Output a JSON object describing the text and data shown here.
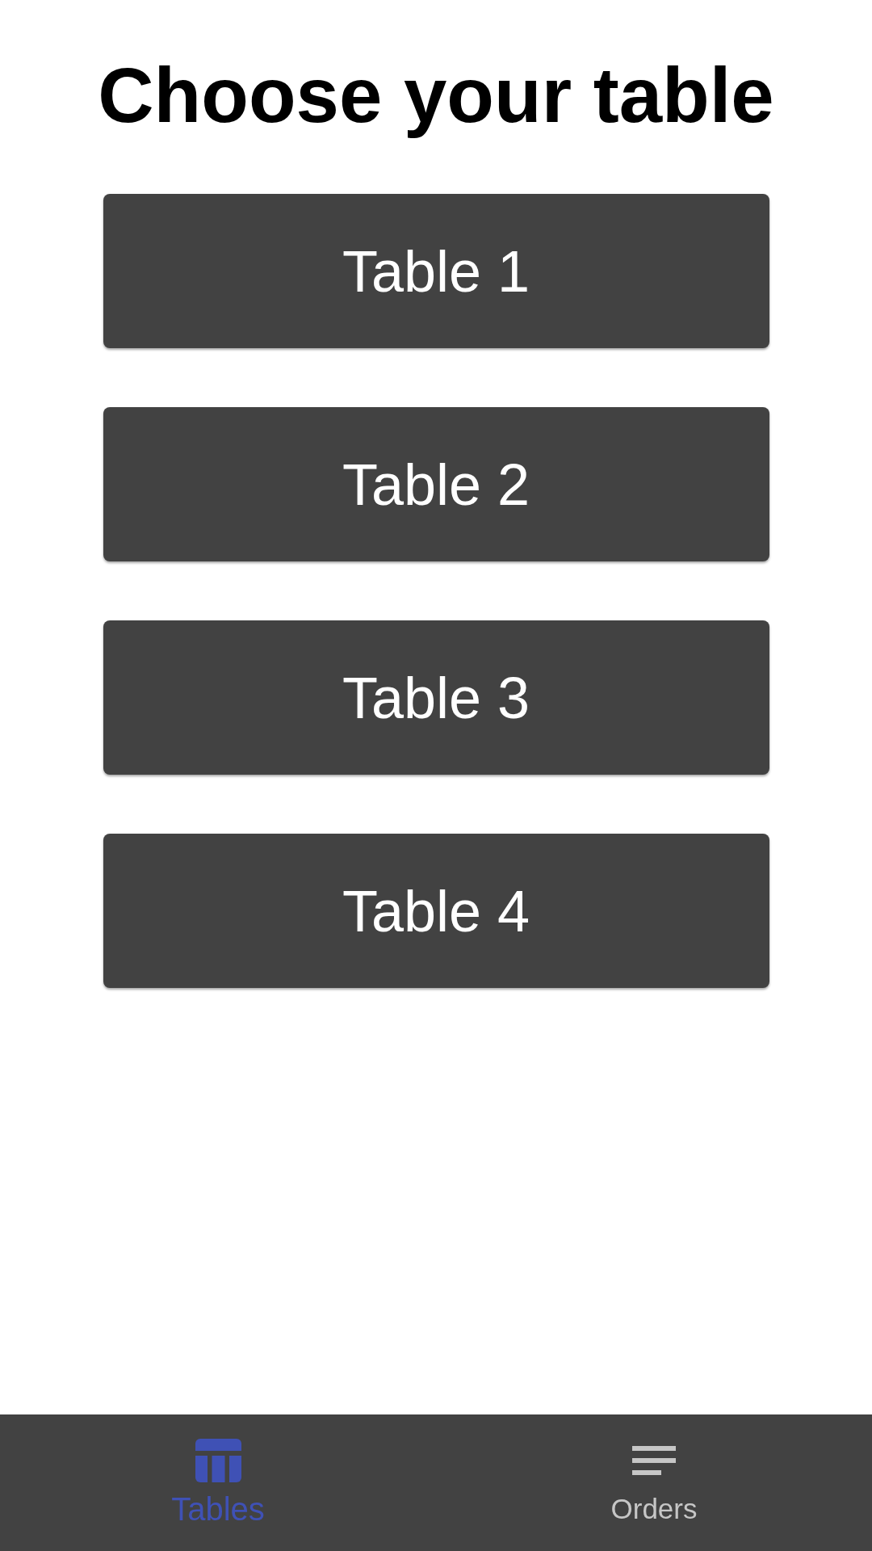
{
  "title": "Choose your table",
  "tables": [
    {
      "label": "Table 1"
    },
    {
      "label": "Table 2"
    },
    {
      "label": "Table 3"
    },
    {
      "label": "Table 4"
    }
  ],
  "bottom_nav": [
    {
      "kind": "grid",
      "label": "Tables",
      "selected": true
    },
    {
      "kind": "lines",
      "label": "Orders",
      "selected": false
    }
  ]
}
